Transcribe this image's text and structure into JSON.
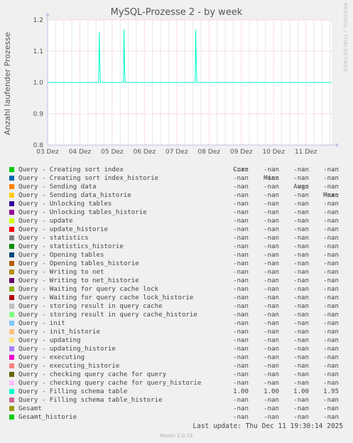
{
  "watermark": "RRDTOOL / TOBI OETIKER",
  "chart_data": {
    "type": "line",
    "title": "MySQL-Prozesse 2 - by week",
    "ylabel": "Anzahl laufender Prozesse",
    "xlabel": "",
    "ylim": [
      0.8,
      1.2
    ],
    "yticks": [
      "0.8",
      "0.9",
      "1.0",
      "1.1",
      "1.2"
    ],
    "xlim_days": [
      0,
      8.8
    ],
    "xticks": [
      "03 Dez",
      "04 Dez",
      "05 Dez",
      "06 Dez",
      "07 Dez",
      "08 Dez",
      "09 Dez",
      "10 Dez",
      "11 Dez"
    ],
    "grid": true,
    "series": [
      {
        "name": "Query - Filling schema table",
        "color": "#00ffcc",
        "x_days": [
          0,
          1.58,
          1.6,
          1.62,
          1.64,
          2.35,
          2.37,
          2.39,
          2.41,
          4.57,
          4.59,
          4.61,
          4.63,
          8.8
        ],
        "values": [
          1.0,
          1.0,
          1.16,
          1.05,
          1.0,
          1.0,
          1.17,
          1.03,
          1.0,
          1.0,
          1.17,
          1.04,
          1.0,
          1.0
        ]
      }
    ]
  },
  "legend": {
    "headers": [
      "Cur:",
      "Min:",
      "Avg:",
      "Max:"
    ],
    "rows": [
      {
        "label": "Query - Creating sort index",
        "color": "#00cc00",
        "cur": "-nan",
        "min": "-nan",
        "avg": "-nan",
        "max": "-nan"
      },
      {
        "label": "Query - Creating sort index_historie",
        "color": "#0066b3",
        "cur": "-nan",
        "min": "-nan",
        "avg": "-nan",
        "max": "-nan"
      },
      {
        "label": "Query - Sending data",
        "color": "#ff8000",
        "cur": "-nan",
        "min": "-nan",
        "avg": "-nan",
        "max": "-nan"
      },
      {
        "label": "Query - Sending data_historie",
        "color": "#ffcc00",
        "cur": "-nan",
        "min": "-nan",
        "avg": "-nan",
        "max": "-nan"
      },
      {
        "label": "Query - Unlocking tables",
        "color": "#330099",
        "cur": "-nan",
        "min": "-nan",
        "avg": "-nan",
        "max": "-nan"
      },
      {
        "label": "Query - Unlocking tables_historie",
        "color": "#990099",
        "cur": "-nan",
        "min": "-nan",
        "avg": "-nan",
        "max": "-nan"
      },
      {
        "label": "Query - update",
        "color": "#ccff00",
        "cur": "-nan",
        "min": "-nan",
        "avg": "-nan",
        "max": "-nan"
      },
      {
        "label": "Query - update_historie",
        "color": "#ff0000",
        "cur": "-nan",
        "min": "-nan",
        "avg": "-nan",
        "max": "-nan"
      },
      {
        "label": "Query - statistics",
        "color": "#808080",
        "cur": "-nan",
        "min": "-nan",
        "avg": "-nan",
        "max": "-nan"
      },
      {
        "label": "Query - statistics_historie",
        "color": "#008f00",
        "cur": "-nan",
        "min": "-nan",
        "avg": "-nan",
        "max": "-nan"
      },
      {
        "label": "Query - Opening tables",
        "color": "#00487d",
        "cur": "-nan",
        "min": "-nan",
        "avg": "-nan",
        "max": "-nan"
      },
      {
        "label": "Query - Opening tables_historie",
        "color": "#b35a00",
        "cur": "-nan",
        "min": "-nan",
        "avg": "-nan",
        "max": "-nan"
      },
      {
        "label": "Query - Writing to net",
        "color": "#b38f00",
        "cur": "-nan",
        "min": "-nan",
        "avg": "-nan",
        "max": "-nan"
      },
      {
        "label": "Query - Writing to net_historie",
        "color": "#6b006b",
        "cur": "-nan",
        "min": "-nan",
        "avg": "-nan",
        "max": "-nan"
      },
      {
        "label": "Query - Waiting for query cache lock",
        "color": "#8fb300",
        "cur": "-nan",
        "min": "-nan",
        "avg": "-nan",
        "max": "-nan"
      },
      {
        "label": "Query - Waiting for query cache lock_historie",
        "color": "#b30000",
        "cur": "-nan",
        "min": "-nan",
        "avg": "-nan",
        "max": "-nan"
      },
      {
        "label": "Query - storing result in query cache",
        "color": "#bebebe",
        "cur": "-nan",
        "min": "-nan",
        "avg": "-nan",
        "max": "-nan"
      },
      {
        "label": "Query - storing result in query cache_historie",
        "color": "#80ff80",
        "cur": "-nan",
        "min": "-nan",
        "avg": "-nan",
        "max": "-nan"
      },
      {
        "label": "Query - init",
        "color": "#80c9ff",
        "cur": "-nan",
        "min": "-nan",
        "avg": "-nan",
        "max": "-nan"
      },
      {
        "label": "Query - init_historie",
        "color": "#ffc080",
        "cur": "-nan",
        "min": "-nan",
        "avg": "-nan",
        "max": "-nan"
      },
      {
        "label": "Query - updating",
        "color": "#ffe680",
        "cur": "-nan",
        "min": "-nan",
        "avg": "-nan",
        "max": "-nan"
      },
      {
        "label": "Query - updating_historie",
        "color": "#aa80ff",
        "cur": "-nan",
        "min": "-nan",
        "avg": "-nan",
        "max": "-nan"
      },
      {
        "label": "Query - executing",
        "color": "#ee00cc",
        "cur": "-nan",
        "min": "-nan",
        "avg": "-nan",
        "max": "-nan"
      },
      {
        "label": "Query - executing_historie",
        "color": "#ff8080",
        "cur": "-nan",
        "min": "-nan",
        "avg": "-nan",
        "max": "-nan"
      },
      {
        "label": "Query - checking query cache for query",
        "color": "#666600",
        "cur": "-nan",
        "min": "-nan",
        "avg": "-nan",
        "max": "-nan"
      },
      {
        "label": "Query - checking query cache for query_historie",
        "color": "#ffbfff",
        "cur": "-nan",
        "min": "-nan",
        "avg": "-nan",
        "max": "-nan"
      },
      {
        "label": "Query - Filling schema table",
        "color": "#00ffcc",
        "cur": "1.00",
        "min": "1.00",
        "avg": "1.00",
        "max": "1.95"
      },
      {
        "label": "Query - Filling schema table_historie",
        "color": "#cc6699",
        "cur": "-nan",
        "min": "-nan",
        "avg": "-nan",
        "max": "-nan"
      },
      {
        "label": "Gesamt",
        "color": "#999900",
        "cur": "-nan",
        "min": "-nan",
        "avg": "-nan",
        "max": "-nan"
      },
      {
        "label": "Gesamt_historie",
        "color": "#00cc00",
        "cur": "-nan",
        "min": "-nan",
        "avg": "-nan",
        "max": "-nan"
      }
    ]
  },
  "footer": {
    "last_update": "Last update: Thu Dec 11 19:30:14 2025",
    "munin_version": "Munin 2.0.73"
  }
}
